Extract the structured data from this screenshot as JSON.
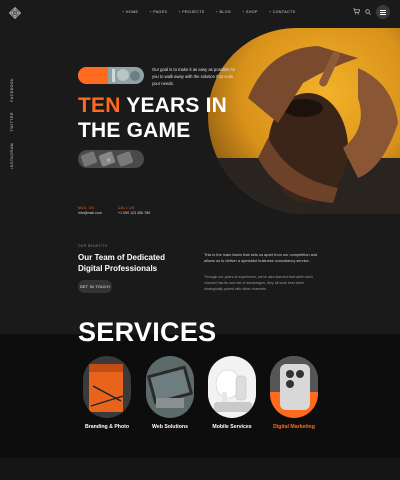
{
  "nav": {
    "items": [
      {
        "label": "HOME"
      },
      {
        "label": "PAGES"
      },
      {
        "label": "PROJECTS"
      },
      {
        "label": "BLOG"
      },
      {
        "label": "SHOP"
      },
      {
        "label": "CONTACTS"
      }
    ],
    "icons": [
      "logo-icon",
      "cart-icon",
      "search-icon",
      "menu-icon"
    ]
  },
  "social": {
    "items": [
      {
        "label": "FACEBOOK"
      },
      {
        "label": "TWITTER"
      },
      {
        "label": "INSTAGRAM"
      }
    ]
  },
  "hero": {
    "intro": "Our goal is to make it as easy as possible for you to walk away with the solution that suits your needs.",
    "headline_accent": "TEN",
    "headline_rest_1": " YEARS IN",
    "headline_rest_2": "THE GAME",
    "mail_label": "MAIL US",
    "mail_value": "info@mail.com",
    "call_label": "CALL US",
    "call_value": "+1 000 123 456 789"
  },
  "about": {
    "eyebrow": "OUR BENEFITS",
    "heading": "Our Team of Dedicated Digital Professionals",
    "button": "GET IN TOUCH",
    "para1": "This is the main factor that sets us apart from our competition and allows us to deliver a specialist business consultancy service.",
    "para2": "Through our years of experience, we've also learned that while each channel has its own set of advantages, they all work best when strategically paired with other channels."
  },
  "services": {
    "title": "SERVICES",
    "items": [
      {
        "label": "Branding & Photo"
      },
      {
        "label": "Web Solutions"
      },
      {
        "label": "Mobile Services"
      },
      {
        "label": "Digital Marketing"
      }
    ]
  },
  "colors": {
    "accent": "#ff6a1f",
    "background": "#1a1a1a",
    "band": "#0d0d0d"
  }
}
